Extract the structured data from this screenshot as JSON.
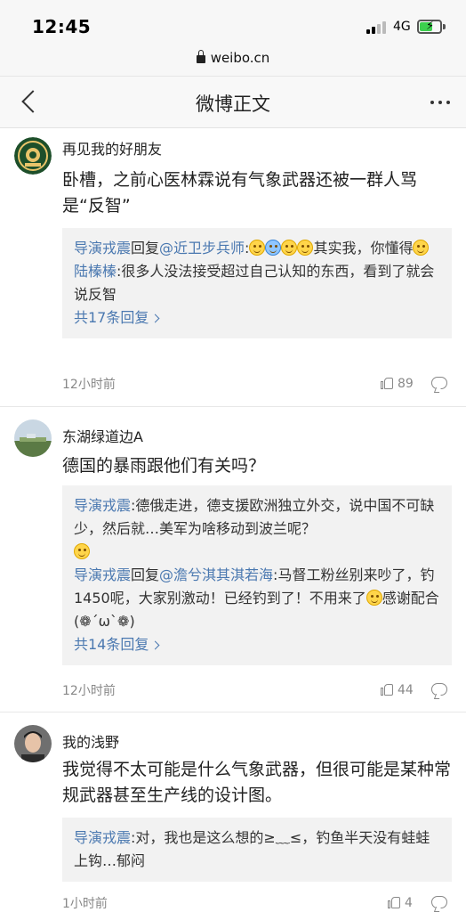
{
  "status_bar": {
    "time": "12:45",
    "network": "4G"
  },
  "url_bar": {
    "domain": "weibo.cn"
  },
  "header": {
    "title": "微博正文"
  },
  "comments": [
    {
      "username": "再见我的好朋友",
      "text": "卧槽，之前心医林霖说有气象武器还被一群人骂是“反智”",
      "replies": [
        {
          "author": "导演戎震",
          "reply_word": "回复",
          "target": "@近卫步兵师",
          "text_a": ":",
          "text_b": "其实我，你懂得"
        },
        {
          "author": "陆榛榛",
          "text": ":很多人没法接受超过自己认知的东西，看到了就会说反智"
        }
      ],
      "more_replies": "共17条回复",
      "time": "12小时前",
      "likes": "89"
    },
    {
      "username": "东湖绿道边A",
      "text": "德国的暴雨跟他们有关吗？",
      "replies": [
        {
          "author": "导演戎震",
          "text": ":德俄走进，德支援欧洲独立外交，说中国不可缺少，然后就…美军为啥移动到波兰呢？"
        },
        {
          "author": "导演戎震",
          "reply_word": "回复",
          "target": "@澹兮淇其淇若海",
          "text": ":马督工粉丝别来吵了，钓1450呢，大家别激动！已经钓到了！不用来了",
          "text_b": "感谢配合(❁´ω`❁)"
        }
      ],
      "more_replies": "共14条回复",
      "time": "12小时前",
      "likes": "44"
    },
    {
      "username": "我的浅野",
      "text": "我觉得不太可能是什么气象武器，但很可能是某种常规武器甚至生产线的设计图。",
      "replies": [
        {
          "author": "导演戎震",
          "text": ":对，我也是这么想的≥﹏≤，钓鱼半天没有蛙蛙上钩…郁闷"
        }
      ],
      "time": "1小时前",
      "likes": "4"
    }
  ]
}
